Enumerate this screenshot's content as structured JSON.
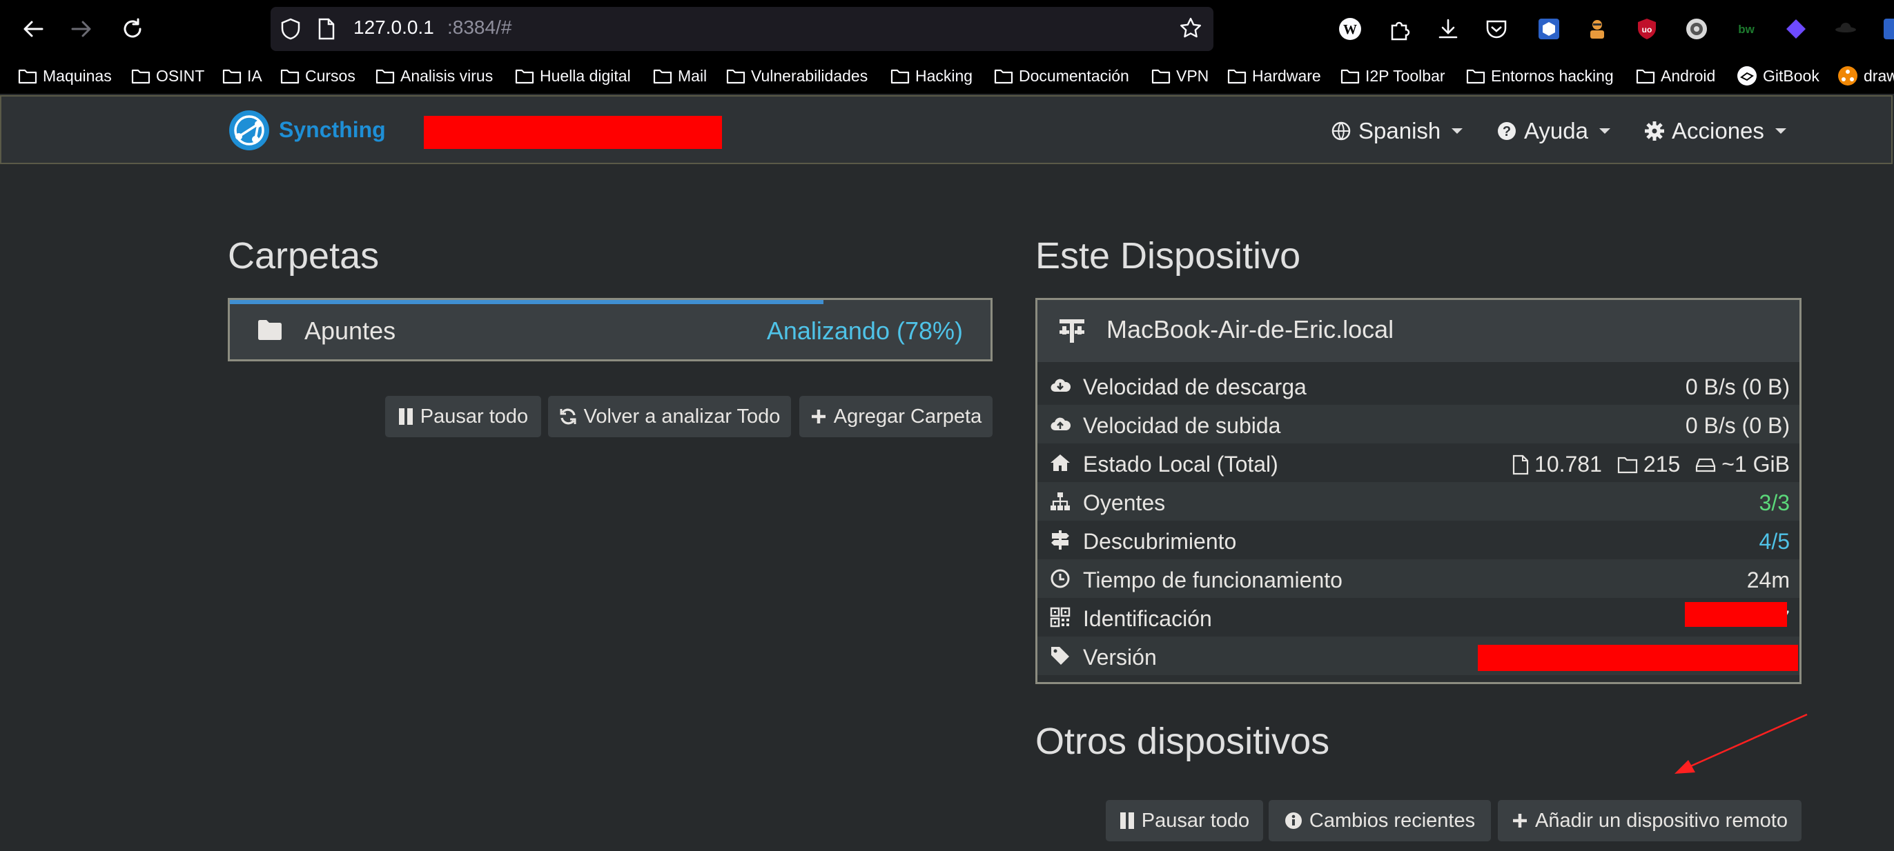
{
  "browser": {
    "url_host": "127.0.0.1",
    "url_rest": ":8384/#",
    "extensions": [
      "wikipedia-icon",
      "extensions-icon",
      "download-icon",
      "pocket-icon",
      "ext-blue-icon",
      "ext-agent-icon",
      "ublock-icon",
      "privacy-icon",
      "bitwarden-icon",
      "proton-icon",
      "spy-icon"
    ],
    "bitwarden_label": "bw"
  },
  "bookmarks": [
    {
      "label": "Maquinas",
      "icon": "folder-icon"
    },
    {
      "label": "OSINT",
      "icon": "folder-icon"
    },
    {
      "label": "IA",
      "icon": "folder-icon"
    },
    {
      "label": "Cursos",
      "icon": "folder-icon"
    },
    {
      "label": "Analisis virus",
      "icon": "folder-icon"
    },
    {
      "label": "Huella digital",
      "icon": "folder-icon"
    },
    {
      "label": "Mail",
      "icon": "folder-icon"
    },
    {
      "label": "Vulnerabilidades",
      "icon": "folder-icon"
    },
    {
      "label": "Hacking",
      "icon": "folder-icon"
    },
    {
      "label": "Documentación",
      "icon": "folder-icon"
    },
    {
      "label": "VPN",
      "icon": "folder-icon"
    },
    {
      "label": "Hardware",
      "icon": "folder-icon"
    },
    {
      "label": "I2P Toolbar",
      "icon": "folder-icon"
    },
    {
      "label": "Entornos hacking",
      "icon": "folder-icon"
    },
    {
      "label": "Android",
      "icon": "folder-icon"
    },
    {
      "label": "GitBook",
      "icon": "gitbook-icon"
    },
    {
      "label": "draw",
      "icon": "drawio-icon"
    }
  ],
  "navbar": {
    "brand": "Syncthing",
    "language": "Spanish",
    "help": "Ayuda",
    "actions": "Acciones"
  },
  "folders": {
    "title": "Carpetas",
    "items": [
      {
        "name": "Apuntes",
        "status": "Analizando (78%)",
        "progress": 0.78
      }
    ],
    "buttons": {
      "pause_all": "Pausar todo",
      "rescan_all": "Volver a analizar Todo",
      "add_folder": "Agregar Carpeta"
    }
  },
  "this_device": {
    "title": "Este Dispositivo",
    "name": "MacBook-Air-de-Eric.local",
    "rows": [
      {
        "label": "Velocidad de descarga",
        "value": "0 B/s (0 B)",
        "icon": "cloud-download-icon"
      },
      {
        "label": "Velocidad de subida",
        "value": "0 B/s (0 B)",
        "icon": "cloud-upload-icon"
      },
      {
        "label": "Estado Local (Total)",
        "files": "10.781",
        "dirs": "215",
        "size": "~1 GiB",
        "icon": "home-icon"
      },
      {
        "label": "Oyentes",
        "value": "3/3",
        "icon": "sitemap-icon",
        "color": "#5bd87a"
      },
      {
        "label": "Descubrimiento",
        "value": "4/5",
        "icon": "signpost-icon",
        "color": "#4fc3e8"
      },
      {
        "label": "Tiempo de funcionamiento",
        "value": "24m",
        "icon": "clock-icon"
      },
      {
        "label": "Identificación",
        "value": "7",
        "icon": "qrcode-icon"
      },
      {
        "label": "Versión",
        "value": "",
        "icon": "tag-icon"
      }
    ]
  },
  "other_devices": {
    "title": "Otros dispositivos",
    "buttons": {
      "pause_all": "Pausar todo",
      "recent_changes": "Cambios recientes",
      "add_remote": "Añadir un dispositivo remoto"
    }
  },
  "colors": {
    "background": "#272a2c",
    "accent_blue": "#4fc3e8",
    "ok_green": "#5bd87a",
    "redaction": "#ff0000",
    "annotation_arrow": "#ff2020"
  }
}
